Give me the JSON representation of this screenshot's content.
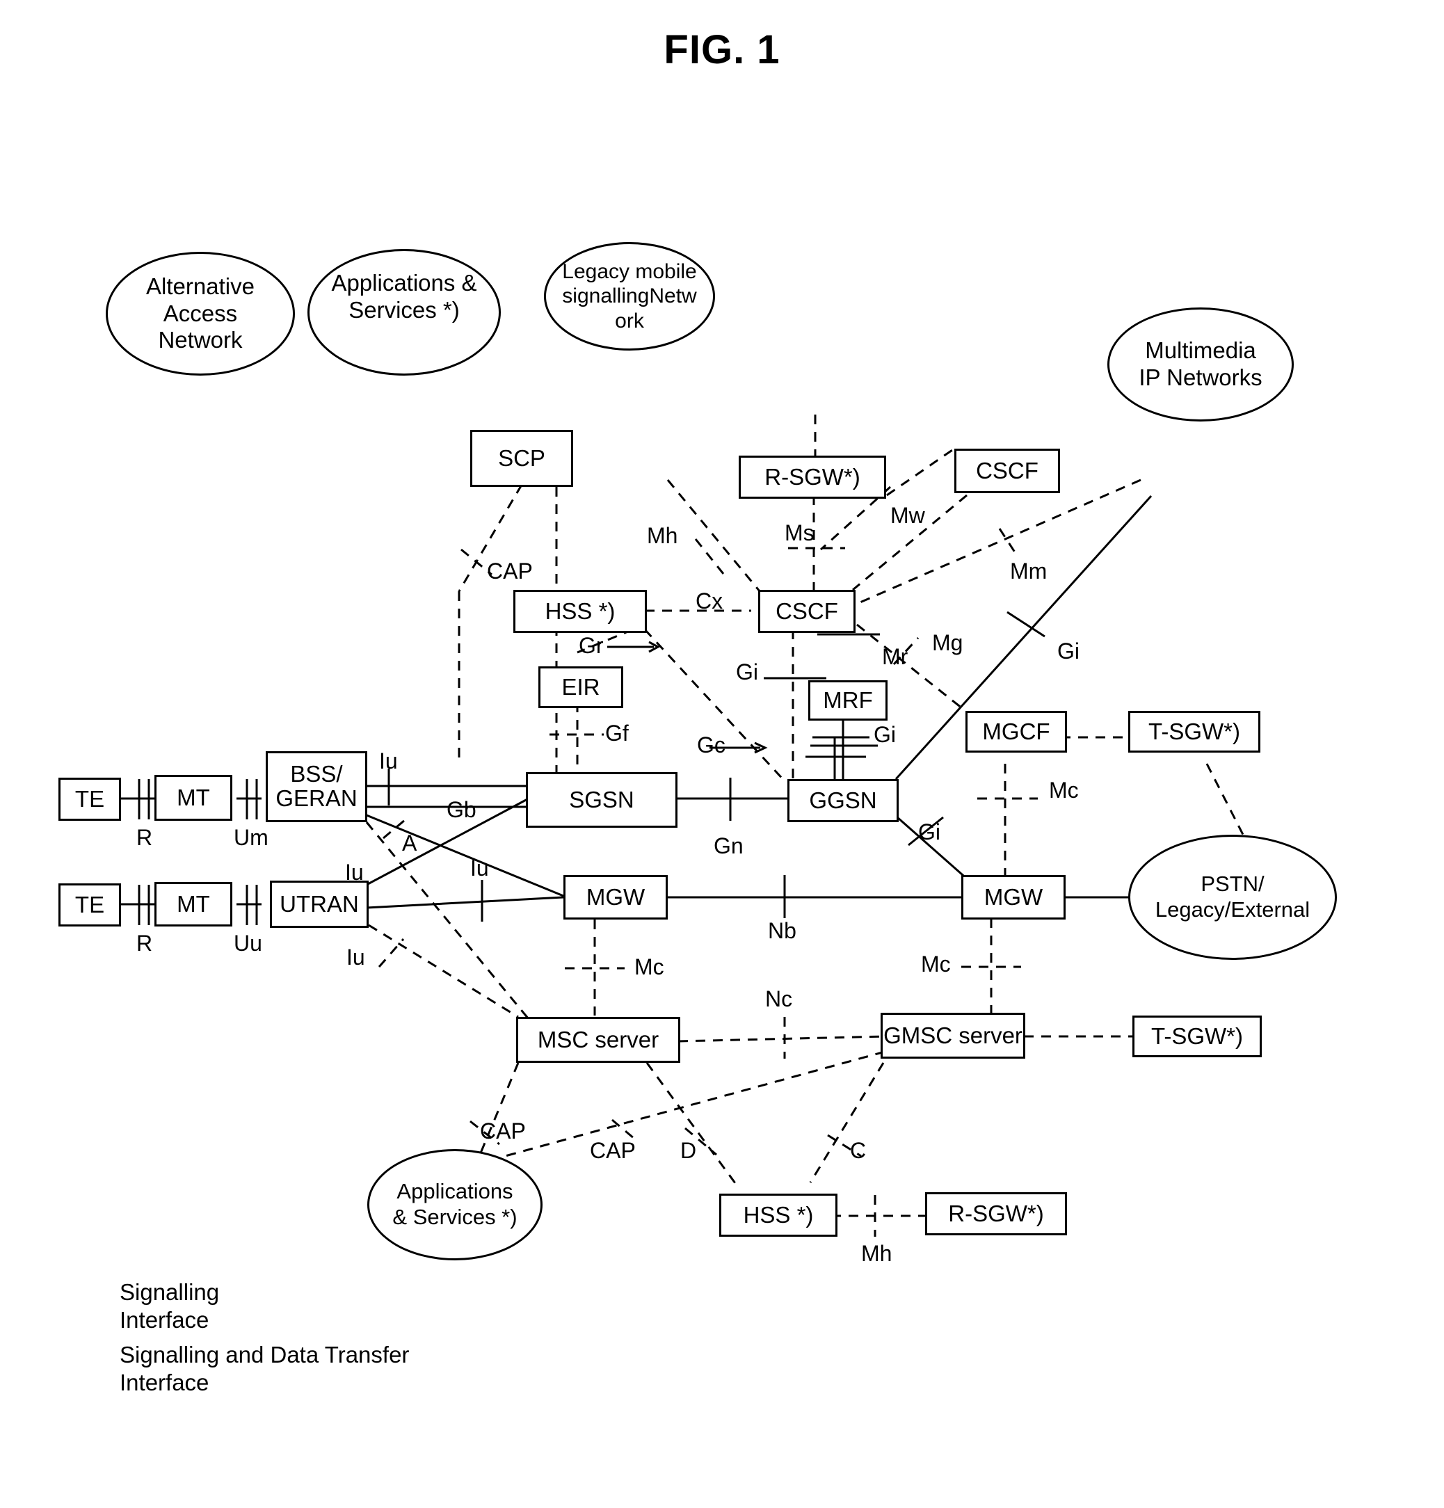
{
  "figure": {
    "title": "FIG. 1"
  },
  "clouds": [
    {
      "id": "alternative-access-network",
      "label": "Alternative\nAccess\nNetwork"
    },
    {
      "id": "applications-services-top",
      "label": "Applications &\nServices  *)"
    },
    {
      "id": "legacy-mobile-signalling-network",
      "label": "Legacy mobile\nsignallingNetw ork"
    },
    {
      "id": "multimedia-ip-networks",
      "label": "Multimedia\nIP Networks"
    },
    {
      "id": "pstn-legacy-external",
      "label": "PSTN/\nLegacy/External"
    },
    {
      "id": "applications-services-bottom",
      "label": "Applications\n& Services *)"
    }
  ],
  "nodes": [
    {
      "id": "scp",
      "label": "SCP"
    },
    {
      "id": "r-sgw-top",
      "label": "R-SGW*)"
    },
    {
      "id": "cscf-top",
      "label": "CSCF"
    },
    {
      "id": "hss-top",
      "label": "HSS *)"
    },
    {
      "id": "cscf-main",
      "label": "CSCF"
    },
    {
      "id": "eir",
      "label": "EIR"
    },
    {
      "id": "mrf",
      "label": "MRF"
    },
    {
      "id": "mgcf",
      "label": "MGCF"
    },
    {
      "id": "t-sgw-top",
      "label": "T-SGW*)"
    },
    {
      "id": "te-top",
      "label": "TE"
    },
    {
      "id": "mt-top",
      "label": "MT"
    },
    {
      "id": "bss-geran",
      "label": "BSS/\nGERAN"
    },
    {
      "id": "sgsn",
      "label": "SGSN"
    },
    {
      "id": "ggsn",
      "label": "GGSN"
    },
    {
      "id": "te-bottom",
      "label": "TE"
    },
    {
      "id": "mt-bottom",
      "label": "MT"
    },
    {
      "id": "utran",
      "label": "UTRAN"
    },
    {
      "id": "mgw-left",
      "label": "MGW"
    },
    {
      "id": "mgw-right",
      "label": "MGW"
    },
    {
      "id": "msc-server",
      "label": "MSC server"
    },
    {
      "id": "gmsc-server",
      "label": "GMSC server"
    },
    {
      "id": "t-sgw-bottom",
      "label": "T-SGW*)"
    },
    {
      "id": "hss-bottom",
      "label": "HSS *)"
    },
    {
      "id": "r-sgw-bottom",
      "label": "R-SGW*)"
    }
  ],
  "interface_labels": [
    {
      "id": "cap-top",
      "text": "CAP"
    },
    {
      "id": "mh-top",
      "text": "Mh"
    },
    {
      "id": "ms",
      "text": "Ms"
    },
    {
      "id": "mw",
      "text": "Mw"
    },
    {
      "id": "mm",
      "text": "Mm"
    },
    {
      "id": "cx",
      "text": "Cx"
    },
    {
      "id": "gr",
      "text": "Gr"
    },
    {
      "id": "gi-cscf",
      "text": "Gi"
    },
    {
      "id": "mr",
      "text": "Mr"
    },
    {
      "id": "mg",
      "text": "Mg"
    },
    {
      "id": "gi-right",
      "text": "Gi"
    },
    {
      "id": "gf",
      "text": "Gf"
    },
    {
      "id": "gc",
      "text": "Gc"
    },
    {
      "id": "gi-mrf",
      "text": "Gi"
    },
    {
      "id": "iu-bss",
      "text": "Iu"
    },
    {
      "id": "gb",
      "text": "Gb"
    },
    {
      "id": "mc-mgcf",
      "text": "Mc"
    },
    {
      "id": "r-top",
      "text": "R"
    },
    {
      "id": "um",
      "text": "Um"
    },
    {
      "id": "a-iface",
      "text": "A"
    },
    {
      "id": "gn",
      "text": "Gn"
    },
    {
      "id": "gi-ggsn",
      "text": "Gi"
    },
    {
      "id": "iu-utran-top",
      "text": "Iu"
    },
    {
      "id": "iu-mid",
      "text": "Iu"
    },
    {
      "id": "r-bottom",
      "text": "R"
    },
    {
      "id": "uu",
      "text": "Uu"
    },
    {
      "id": "iu-bottom",
      "text": "Iu"
    },
    {
      "id": "nb",
      "text": "Nb"
    },
    {
      "id": "mc-left",
      "text": "Mc"
    },
    {
      "id": "mc-right",
      "text": "Mc"
    },
    {
      "id": "nc",
      "text": "Nc"
    },
    {
      "id": "cap-left-bottom",
      "text": "CAP"
    },
    {
      "id": "cap-mid-bottom",
      "text": "CAP"
    },
    {
      "id": "d-iface",
      "text": "D"
    },
    {
      "id": "c-iface",
      "text": "C"
    },
    {
      "id": "mh-bottom",
      "text": "Mh"
    }
  ],
  "legend": {
    "signalling": "Signalling\nInterface",
    "signalling_data": "Signalling and Data Transfer\nInterface"
  }
}
